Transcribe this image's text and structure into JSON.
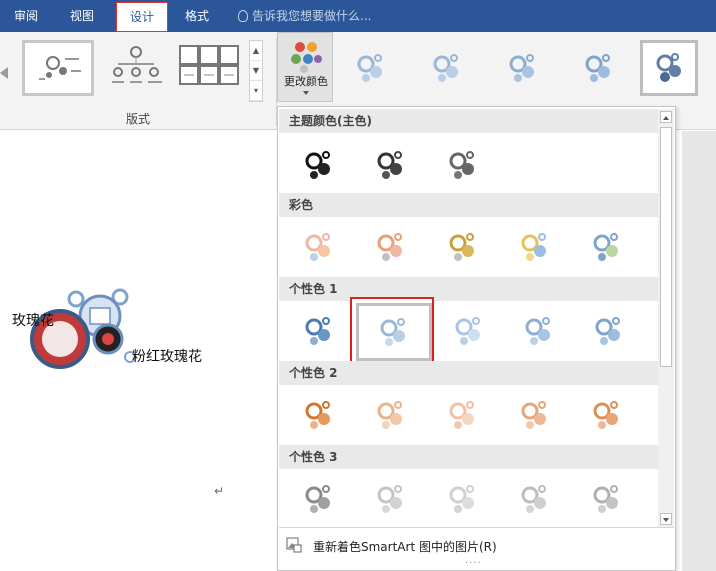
{
  "tabs": [
    "审阅",
    "视图",
    "设计",
    "格式"
  ],
  "active_tab": "设计",
  "tell_me": "告诉我您想要做什么...",
  "layouts_group_label": "版式",
  "change_colors_label": "更改颜色",
  "panel": {
    "sections": [
      "主题颜色(主色)",
      "彩色",
      "个性色 1",
      "个性色 2",
      "个性色 3"
    ],
    "footer_text": "重新着色SmartArt 图中的图片(R)",
    "grip": "····"
  },
  "diagram": {
    "label_rose": "玫瑰花",
    "label_pink_rose": "粉红玫瑰花"
  },
  "paragraph_mark": "↵",
  "colors": {
    "ribbon_blue": "#2b579a",
    "highlight": "#e02020"
  }
}
